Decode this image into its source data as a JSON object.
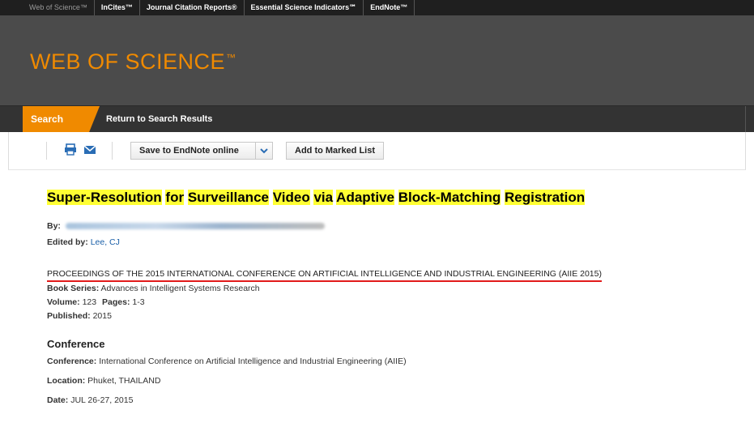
{
  "product_bar": {
    "items": [
      "Web of Science™",
      "InCites™",
      "Journal Citation Reports®",
      "Essential Science Indicators℠",
      "EndNote™"
    ]
  },
  "header": {
    "logo_text": "WEB OF SCIENCE",
    "logo_tm": "™"
  },
  "tabs": {
    "search": "Search",
    "return": "Return to Search Results"
  },
  "toolbar": {
    "print_icon": "print-icon",
    "email_icon": "email-icon",
    "save_label": "Save to EndNote online",
    "add_marked_label": "Add to Marked List"
  },
  "record": {
    "title_parts": [
      {
        "text": "Super-Resolution",
        "hl": true
      },
      {
        "text": " ",
        "hl": false
      },
      {
        "text": "for",
        "hl": true
      },
      {
        "text": " ",
        "hl": false
      },
      {
        "text": "Surveillance",
        "hl": true
      },
      {
        "text": " ",
        "hl": false
      },
      {
        "text": "Video",
        "hl": true
      },
      {
        "text": " ",
        "hl": false
      },
      {
        "text": "via",
        "hl": true
      },
      {
        "text": " ",
        "hl": false
      },
      {
        "text": "Adaptive",
        "hl": true
      },
      {
        "text": " ",
        "hl": false
      },
      {
        "text": "Block-Matching",
        "hl": true
      },
      {
        "text": " ",
        "hl": false
      },
      {
        "text": "Registration",
        "hl": true
      }
    ],
    "by_label": "By:",
    "edited_label": "Edited by:",
    "edited_value": "Lee, CJ",
    "source_title": "PROCEEDINGS OF THE 2015 INTERNATIONAL CONFERENCE ON ARTIFICIAL INTELLIGENCE AND INDUSTRIAL ENGINEERING (AIIE 2015)",
    "book_series_label": "Book Series:",
    "book_series_value": "Advances in Intelligent Systems Research",
    "volume_label": "Volume:",
    "volume_value": "123",
    "pages_label": "Pages:",
    "pages_value": "1-3",
    "published_label": "Published:",
    "published_value": "2015"
  },
  "conference": {
    "heading": "Conference",
    "conference_label": "Conference:",
    "conference_value": "International Conference on Artificial Intelligence and Industrial Engineering (AIIE)",
    "location_label": "Location:",
    "location_value": "Phuket, THAILAND",
    "date_label": "Date:",
    "date_value": "JUL 26-27, 2015"
  },
  "colors": {
    "brand_orange": "#f08a00",
    "header_gray": "#4b4b4b",
    "highlight": "#ffff33",
    "annotation_red": "#e21b1b",
    "link_blue": "#1a5fa8"
  }
}
